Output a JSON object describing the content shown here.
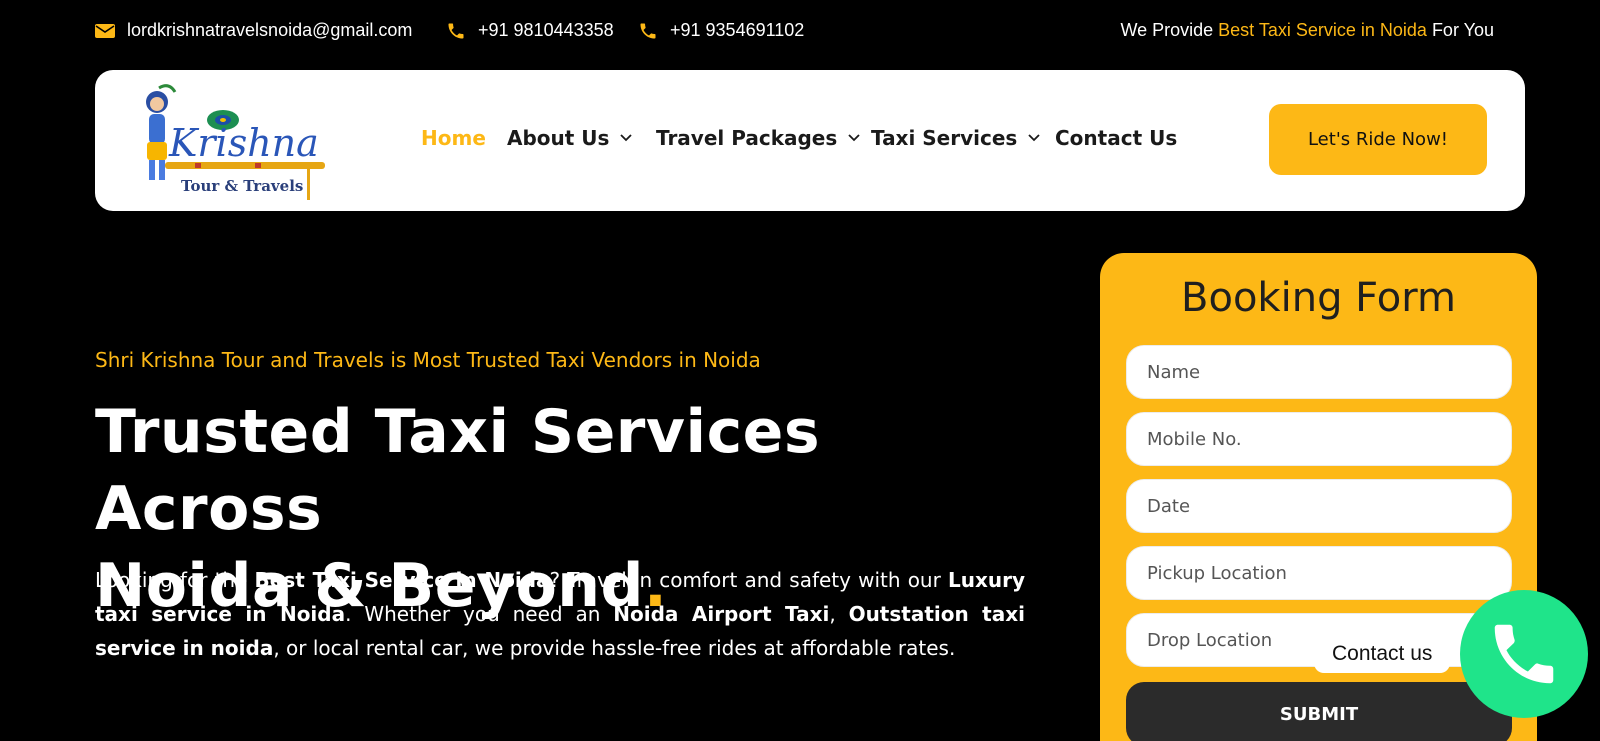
{
  "topbar": {
    "email": "lordkrishnatravelsnoida@gmail.com",
    "phone1": "+91 9810443358",
    "phone2": "+91 9354691102",
    "tagline_prefix": "We Provide ",
    "tagline_highlight": "Best Taxi Service in Noida",
    "tagline_suffix": " For You"
  },
  "logo": {
    "name": "Krishna",
    "sub": "Tour & Travels"
  },
  "nav": {
    "items": [
      {
        "label": "Home"
      },
      {
        "label": "About Us"
      },
      {
        "label": "Travel Packages"
      },
      {
        "label": "Taxi Services"
      },
      {
        "label": "Contact Us"
      }
    ],
    "cta": "Let's Ride Now!"
  },
  "hero": {
    "eyebrow": "Shri Krishna Tour and Travels is Most Trusted Taxi Vendors in Noida",
    "headline_line1": "Trusted Taxi Services Across",
    "headline_line2": "Noida & Beyond",
    "headline_dot": ".",
    "p_1": "Looking for the ",
    "p_2": "Best Taxi Service in Noida",
    "p_3": "? Travel in comfort and safety with our ",
    "p_4": "Luxury taxi service in Noida",
    "p_5": ". Whether you need an ",
    "p_6": "Noida Airport Taxi",
    "p_7": ", ",
    "p_8": "Outstation taxi service in noida",
    "p_9": ", or local rental car, we provide hassle-free rides at affordable rates."
  },
  "booking": {
    "title": "Booking Form",
    "fields": [
      {
        "placeholder": "Name"
      },
      {
        "placeholder": "Mobile No."
      },
      {
        "placeholder": "Date"
      },
      {
        "placeholder": "Pickup Location"
      },
      {
        "placeholder": "Drop Location"
      }
    ],
    "submit": "SUBMIT"
  },
  "floating": {
    "contact_label": "Contact us"
  },
  "colors": {
    "accent": "#fdb816",
    "background": "#000000",
    "call_green": "#1fe48a"
  }
}
